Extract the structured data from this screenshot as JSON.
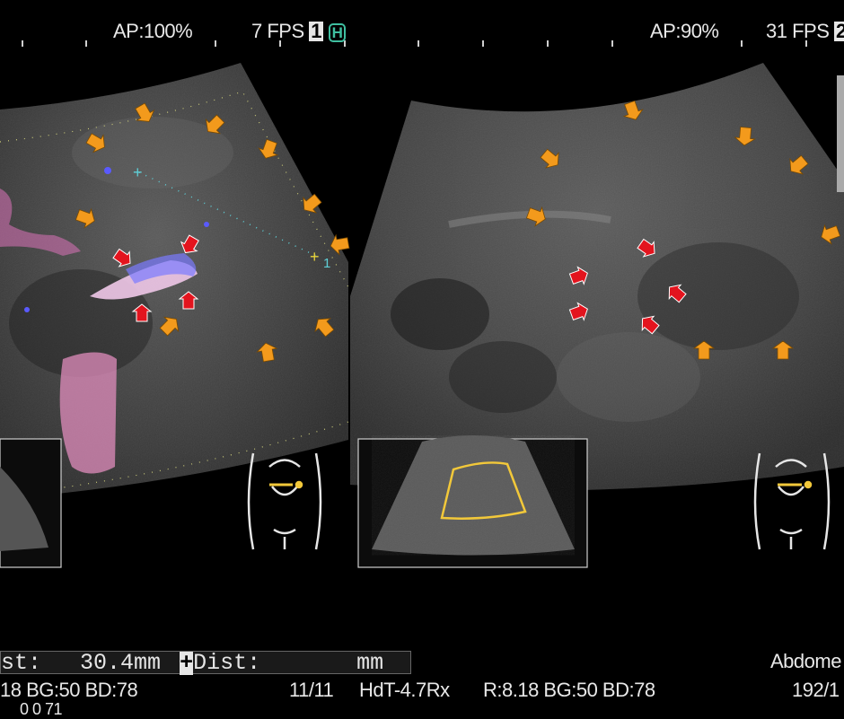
{
  "left_panel": {
    "ap": "AP:100%",
    "fps": "7 FPS",
    "frame_badge": "1",
    "h_badge": "H",
    "caliper_number": "1"
  },
  "right_panel": {
    "ap": "AP:90%",
    "fps": "31 FPS",
    "frame_badge": "2"
  },
  "measurement_bar": {
    "dist_label": "st:",
    "dist_value": "30.4mm",
    "plus_label": "+",
    "dist2_label": "Dist:",
    "dist2_unit": "mm"
  },
  "status_line": {
    "left_params": "18 BG:50  BD:78",
    "frame_count": "11/11",
    "probe": "HdT-4.7Rx",
    "right_params": "R:8.18  BG:50  BD:78",
    "right_count": "192/1",
    "exam": "Abdome",
    "bottom_partial": "0 0 71"
  },
  "colors": {
    "orange_arrow": "#f39a1c",
    "red_arrow": "#e3141e",
    "caliper_cyan": "#5fd0d8",
    "caliper_yellow": "#e8d23a",
    "probe_box_yellow": "#f2c83a"
  }
}
